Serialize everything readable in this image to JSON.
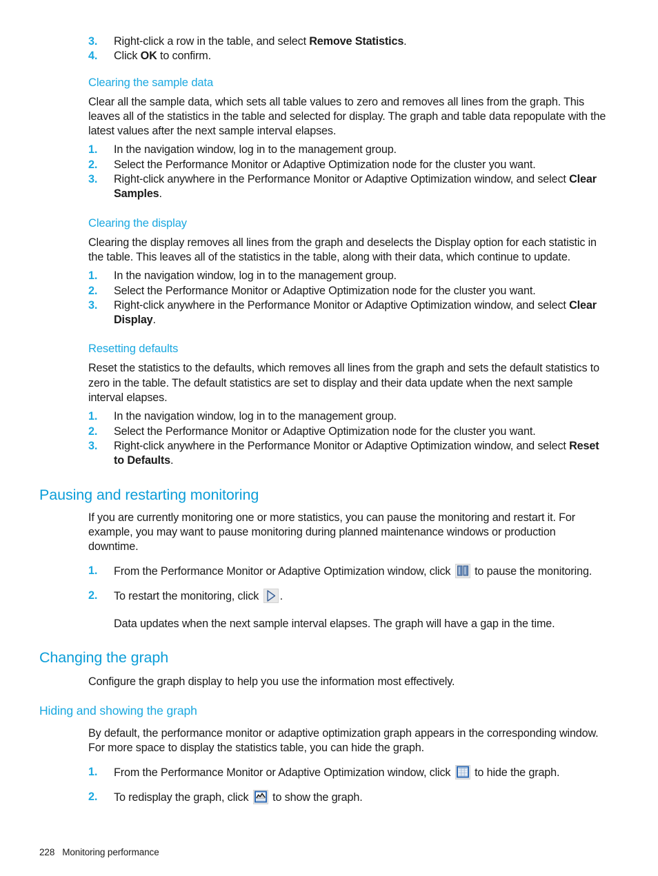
{
  "document": {
    "footer": {
      "page_number": "228",
      "chapter": "Monitoring performance"
    },
    "colors": {
      "heading_blue": "#0b9dd8",
      "subheading_blue": "#1aa8e0",
      "body_black": "#1a1a1a"
    }
  },
  "top_steps": [
    {
      "num": "3.",
      "text_before": "Right-click a row in the table, and select ",
      "bold": "Remove Statistics",
      "text_after": "."
    },
    {
      "num": "4.",
      "text_before": "Click ",
      "bold": "OK",
      "text_after": " to confirm."
    }
  ],
  "sections": [
    {
      "heading": "Clearing the sample data",
      "level": "h3",
      "body": "Clear all the sample data, which sets all table values to zero and removes all lines from the graph. This leaves all of the statistics in the table and selected for display. The graph and table data repopulate with the latest values after the next sample interval elapses.",
      "steps": [
        {
          "num": "1.",
          "text_before": "In the navigation window, log in to the management group.",
          "bold": "",
          "text_after": ""
        },
        {
          "num": "2.",
          "text_before": "Select the Performance Monitor or Adaptive Optimization node for the cluster you want.",
          "bold": "",
          "text_after": ""
        },
        {
          "num": "3.",
          "text_before": "Right-click anywhere in the Performance Monitor or Adaptive Optimization window, and select ",
          "bold": "Clear Samples",
          "text_after": "."
        }
      ]
    },
    {
      "heading": "Clearing the display",
      "level": "h3",
      "body": "Clearing the display removes all lines from the graph and deselects the Display option for each statistic in the table. This leaves all of the statistics in the table, along with their data, which continue to update.",
      "steps": [
        {
          "num": "1.",
          "text_before": "In the navigation window, log in to the management group.",
          "bold": "",
          "text_after": ""
        },
        {
          "num": "2.",
          "text_before": "Select the Performance Monitor or Adaptive Optimization node for the cluster you want.",
          "bold": "",
          "text_after": ""
        },
        {
          "num": "3.",
          "text_before": "Right-click anywhere in the Performance Monitor or Adaptive Optimization window, and select ",
          "bold": "Clear Display",
          "text_after": "."
        }
      ]
    },
    {
      "heading": "Resetting defaults",
      "level": "h3",
      "body": "Reset the statistics to the defaults, which removes all lines from the graph and sets the default statistics to zero in the table. The default statistics are set to display and their data update when the next sample interval elapses.",
      "steps": [
        {
          "num": "1.",
          "text_before": "In the navigation window, log in to the management group.",
          "bold": "",
          "text_after": ""
        },
        {
          "num": "2.",
          "text_before": "Select the Performance Monitor or Adaptive Optimization node for the cluster you want.",
          "bold": "",
          "text_after": ""
        },
        {
          "num": "3.",
          "text_before": "Right-click anywhere in the Performance Monitor or Adaptive Optimization window, and select ",
          "bold": "Reset to Defaults",
          "text_after": "."
        }
      ]
    }
  ],
  "pausing_section": {
    "heading": "Pausing and restarting monitoring",
    "body": "If you are currently monitoring one or more statistics, you can pause the monitoring and restart it. For example, you may want to pause monitoring during planned maintenance windows or production downtime.",
    "step1": {
      "num": "1.",
      "text_before": "From the Performance Monitor or Adaptive Optimization window, click ",
      "icon": "pause-icon",
      "text_after": " to pause the monitoring."
    },
    "step2": {
      "num": "2.",
      "text_before": "To restart the monitoring, click ",
      "icon": "play-icon",
      "text_after": "."
    },
    "step2_note": "Data updates when the next sample interval elapses. The graph will have a gap in the time."
  },
  "changing_section": {
    "heading": "Changing the graph",
    "body": "Configure the graph display to help you use the information most effectively."
  },
  "hiding_section": {
    "heading": "Hiding and showing the graph",
    "body": "By default, the performance monitor or adaptive optimization graph appears in the corresponding window. For more space to display the statistics table, you can hide the graph.",
    "step1": {
      "num": "1.",
      "text_before": "From the Performance Monitor or Adaptive Optimization window, click ",
      "icon": "table-grid-icon",
      "text_after": " to hide the graph."
    },
    "step2": {
      "num": "2.",
      "text_before": "To redisplay the graph, click ",
      "icon": "line-chart-icon",
      "text_after": " to show the graph."
    }
  }
}
